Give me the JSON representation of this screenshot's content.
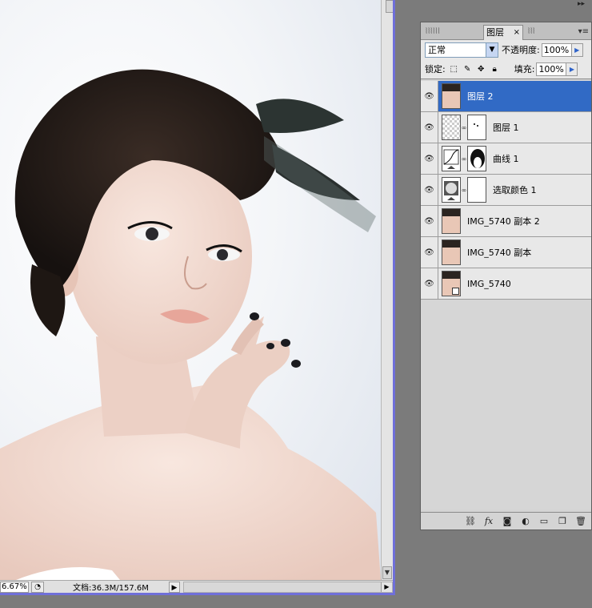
{
  "document": {
    "zoom": "6.67%",
    "doc_size": "文档:36.3M/157.6M",
    "photo_alt": "portrait with feather hair accessory"
  },
  "layers_panel": {
    "tab_label": "图层",
    "tab_close": "×",
    "blend_mode": "正常",
    "opacity_label": "不透明度:",
    "opacity_value": "100%",
    "lock_label": "锁定:",
    "fill_label": "填充:",
    "fill_value": "100%",
    "layers": [
      {
        "name": "图层 2",
        "selected": true,
        "thumb": "face",
        "mask": false
      },
      {
        "name": "图层 1",
        "selected": false,
        "thumb": "checker",
        "mask": true
      },
      {
        "name": "曲线 1",
        "selected": false,
        "thumb": "curves",
        "mask": true
      },
      {
        "name": "选取颜色 1",
        "selected": false,
        "thumb": "selective-color",
        "mask": true
      },
      {
        "name": "IMG_5740 副本 2",
        "selected": false,
        "thumb": "face",
        "mask": false
      },
      {
        "name": "IMG_5740 副本",
        "selected": false,
        "thumb": "face",
        "mask": false
      },
      {
        "name": "IMG_5740",
        "selected": false,
        "thumb": "face-smart",
        "mask": false
      }
    ],
    "footer_icons": [
      "link-icon",
      "fx-icon",
      "add-mask-icon",
      "adjustment-icon",
      "group-folder-icon",
      "new-layer-icon",
      "trash-icon"
    ]
  },
  "colors": {
    "selection": "#316ac5",
    "window_border": "#6f6fd9",
    "workspace": "#7b7b7b"
  }
}
